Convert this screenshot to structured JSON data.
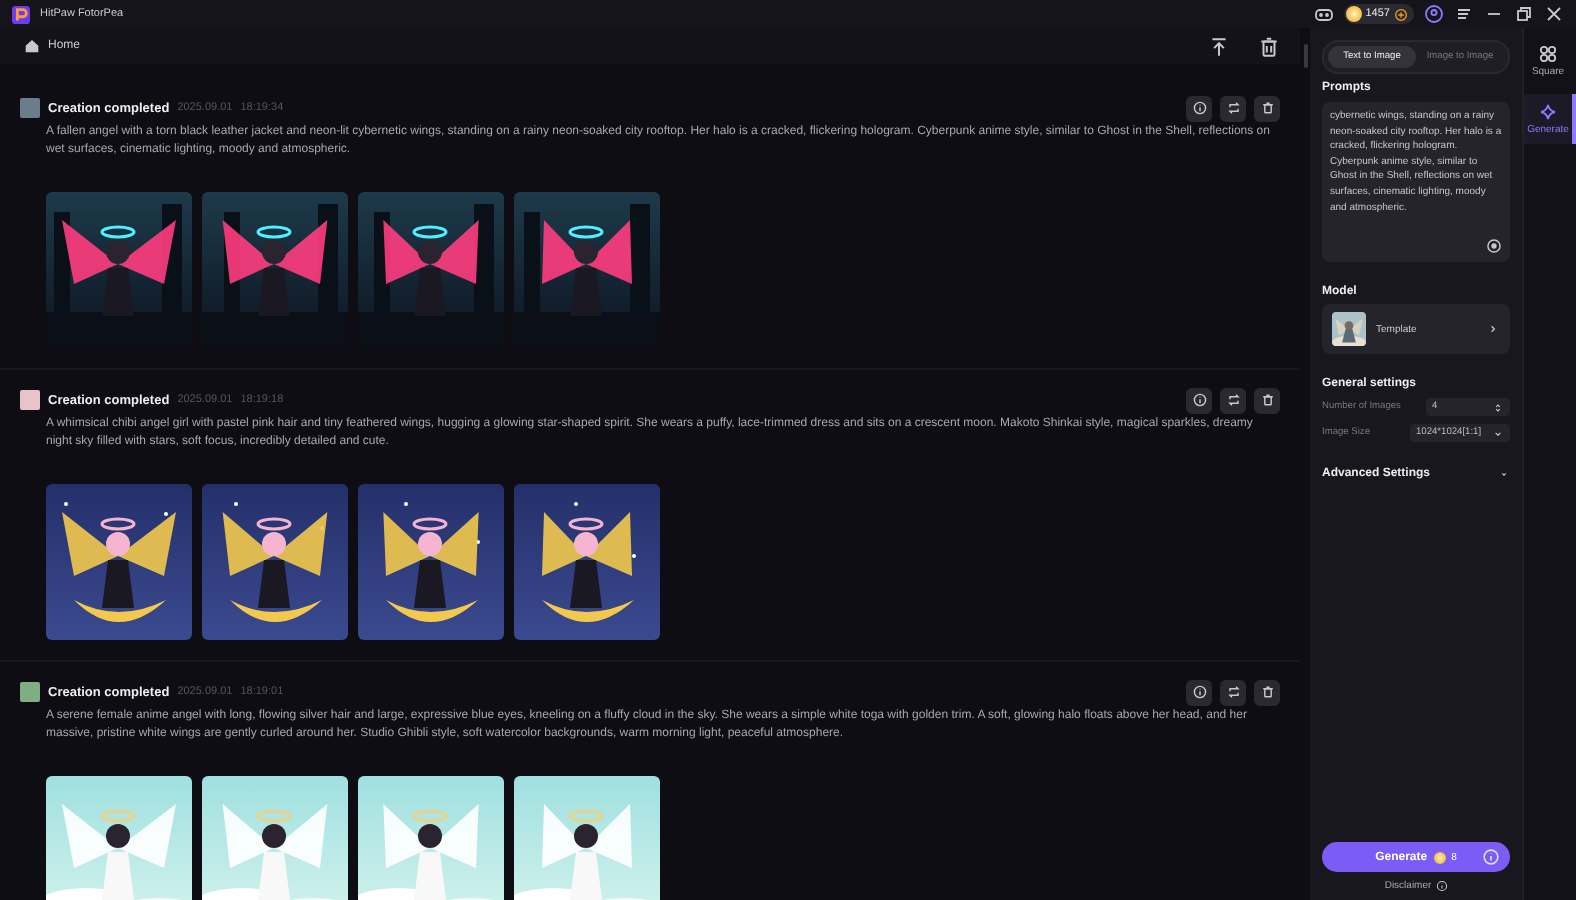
{
  "window": {
    "title": "HitPaw FotorPea",
    "coins": "1457"
  },
  "toolbar": {
    "home": "Home"
  },
  "creations": [
    {
      "status": "Creation completed",
      "date": "2025.09.01",
      "time": "18:19:34",
      "prompt": "A fallen angel with a torn black leather jacket and neon-lit cybernetic wings, standing on a rainy neon-soaked city rooftop. Her halo is a cracked, flickering hologram. Cyberpunk anime style, similar to Ghost in the Shell, reflections on wet surfaces, cinematic lighting, moody and atmospheric."
    },
    {
      "status": "Creation completed",
      "date": "2025.09.01",
      "time": "18:19:18",
      "prompt": "A whimsical chibi angel girl with pastel pink hair and tiny feathered wings, hugging a glowing star-shaped spirit. She wears a puffy, lace-trimmed dress and sits on a crescent moon. Makoto Shinkai style, magical sparkles, dreamy night sky filled with stars, soft focus, incredibly detailed and cute."
    },
    {
      "status": "Creation completed",
      "date": "2025.09.01",
      "time": "18:19:01",
      "prompt": "A serene female anime angel with long, flowing silver hair and large, expressive blue eyes, kneeling on a fluffy cloud in the sky. She wears a simple white toga with golden trim. A soft, glowing halo floats above her head, and her massive, pristine white wings are gently curled around her. Studio Ghibli style, soft watercolor backgrounds, warm morning light, peaceful atmosphere."
    }
  ],
  "panel": {
    "tabs": [
      {
        "label": "Text to Image",
        "selected": true
      },
      {
        "label": "Image to Image",
        "selected": false
      }
    ],
    "prompts_label": "Prompts",
    "prompt_value": "cybernetic wings, standing on a rainy neon-soaked city rooftop. Her halo is a cracked, flickering hologram. Cyberpunk anime style, similar to Ghost in the Shell, reflections on wet surfaces, cinematic lighting, moody and atmospheric.",
    "model_label": "Model",
    "model": "Template",
    "general_label": "General settings",
    "settings": [
      {
        "label": "Number of Images",
        "value": "4",
        "kind": "spinner"
      },
      {
        "label": "Image Size",
        "value": "1024*1024[1:1]",
        "kind": "select"
      }
    ],
    "advanced_label": "Advanced Settings",
    "generate": "Generate",
    "cost": "8",
    "disclaimer": "Disclaimer"
  },
  "nav": [
    {
      "label": "Square",
      "selected": false
    },
    {
      "label": "Generate",
      "selected": true
    }
  ]
}
